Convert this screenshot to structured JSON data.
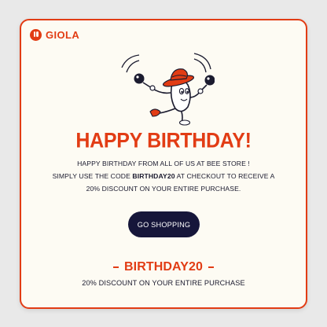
{
  "brand": {
    "name": "GIOLA"
  },
  "hero": {
    "illustration_icon": "dancing-bee-mascot",
    "headline": "HAPPY BIRTHDAY!"
  },
  "message": {
    "line1": "HAPPY BIRTHDAY FROM ALL OF US AT BEE STORE !",
    "line2_prefix": "SIMPLY USE THE CODE ",
    "line2_code": "BIRTHDAY20",
    "line2_suffix": " AT CHECKOUT TO RECEIVE A",
    "line3": "20% DISCOUNT ON YOUR ENTIRE PURCHASE."
  },
  "cta": {
    "label": "GO SHOPPING"
  },
  "promo": {
    "code": "BIRTHDAY20",
    "description": "20% DISCOUNT ON YOUR ENTIRE PURCHASE"
  },
  "colors": {
    "accent": "#e23c14",
    "button": "#16163a",
    "background": "#fdfbf3"
  }
}
